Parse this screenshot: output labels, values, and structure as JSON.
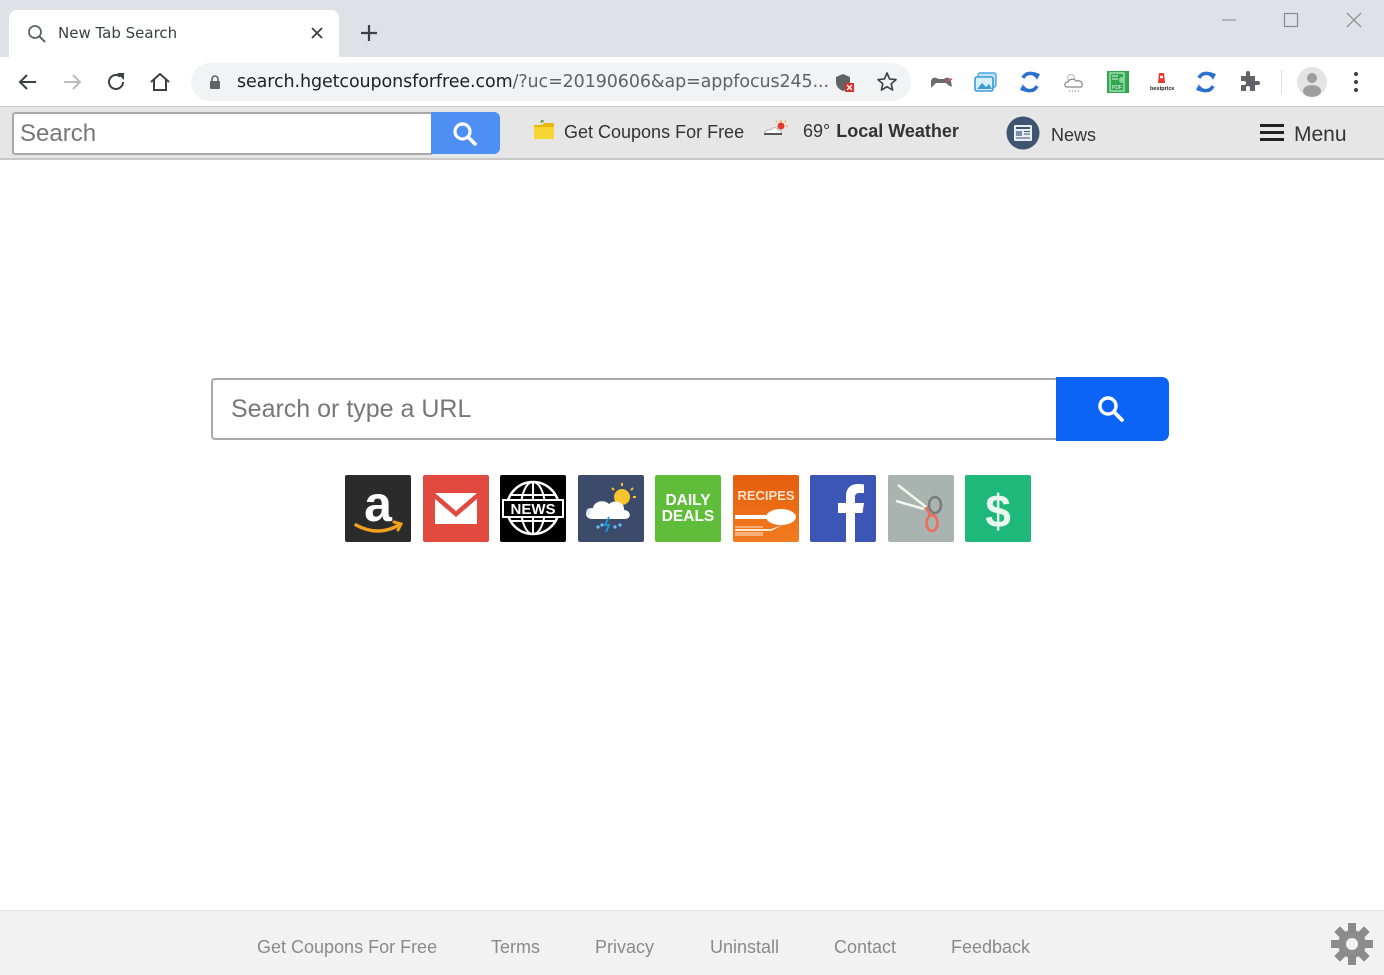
{
  "browser": {
    "tab": {
      "title": "New Tab Search",
      "icon": "search-icon"
    },
    "new_tab_icon": "plus-icon",
    "window_controls": [
      "minimize-icon",
      "maximize-icon",
      "close-icon"
    ],
    "nav": [
      "back-icon",
      "forward-icon",
      "reload-icon",
      "home-icon"
    ],
    "address": {
      "host": "search.hgetcouponsforfree.com",
      "path": "/?uc=20190606&ap=appfocus245...",
      "security_icon": "lock-icon"
    },
    "extensions": [
      "gamepad-icon",
      "photos-icon",
      "sync-icon",
      "weather-icon",
      "pdf-icon",
      "bestprice-icon",
      "sync-icon",
      "puzzle-icon"
    ],
    "bestprice_label": "bestprice",
    "pdf_label": "PDF"
  },
  "ext_toolbar": {
    "search_placeholder": "Search",
    "links": {
      "coupons": "Get Coupons For Free",
      "weather_temp": "69°",
      "weather_label": "Local Weather",
      "news": "News"
    },
    "menu_label": "Menu"
  },
  "main": {
    "search_placeholder": "Search or type a URL",
    "tiles": [
      {
        "name": "amazon",
        "label": "a",
        "color": "#2b2b2b"
      },
      {
        "name": "gmail",
        "label": "",
        "color": "#e24a3f"
      },
      {
        "name": "news",
        "label": "NEWS",
        "color": "#000000"
      },
      {
        "name": "weather",
        "label": "",
        "color": "#3c4b6a"
      },
      {
        "name": "daily-deals",
        "label_line1": "DAILY",
        "label_line2": "DEALS",
        "color": "#5fbd39"
      },
      {
        "name": "recipes",
        "label": "RECIPES",
        "color": "#e8620f"
      },
      {
        "name": "facebook",
        "label": "f",
        "color": "#3b56b5"
      },
      {
        "name": "coupons",
        "label": "",
        "color": "#a9b4b1"
      },
      {
        "name": "money",
        "label": "$",
        "color": "#1db87a"
      }
    ]
  },
  "footer": {
    "links": [
      "Get Coupons For Free",
      "Terms",
      "Privacy",
      "Uninstall",
      "Contact",
      "Feedback"
    ],
    "settings_icon": "gear-icon"
  },
  "colors": {
    "ext_search_button": "#4d8ff2",
    "main_search_button": "#0b64f5"
  }
}
